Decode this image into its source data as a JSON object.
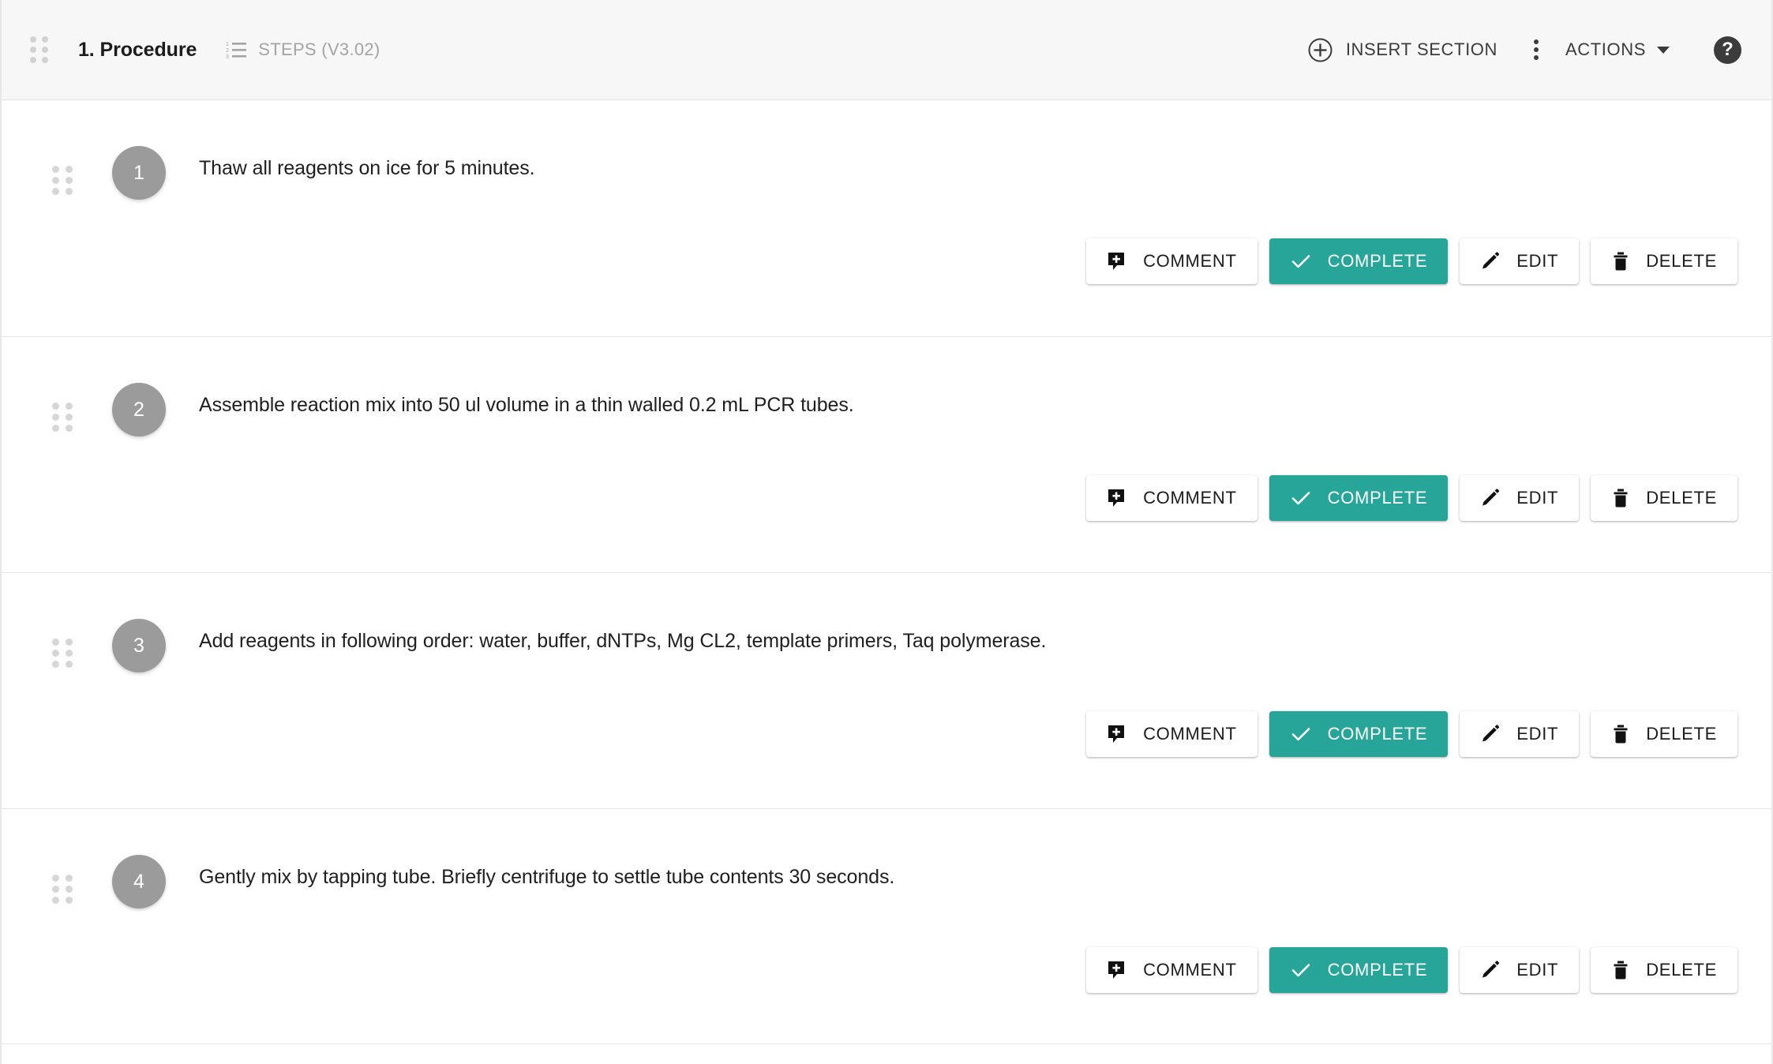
{
  "header": {
    "drag_handle": "drag-handle",
    "title": "1. Procedure",
    "steps_icon": "numbered-list-icon",
    "steps_label": "STEPS (V3.02)",
    "insert_section_label": "INSERT SECTION",
    "insert_section_icon": "plus-circle-icon",
    "kebab_icon": "more-vertical-icon",
    "actions_label": "ACTIONS",
    "actions_caret": "chevron-down-icon",
    "help_icon_label": "?"
  },
  "colors": {
    "accent_teal": "#26a598",
    "header_background": "#f7f7f7",
    "step_circle": "#9b9b9b",
    "muted_text": "#a4a4a4",
    "help_circle": "#3c3c3c"
  },
  "buttons": {
    "comment": "COMMENT",
    "complete": "COMPLETE",
    "edit": "EDIT",
    "delete": "DELETE"
  },
  "steps": [
    {
      "number": "1",
      "text": "Thaw all reagents on ice for 5 minutes."
    },
    {
      "number": "2",
      "text": "Assemble reaction mix into 50 ul volume in a thin walled 0.2 mL PCR tubes."
    },
    {
      "number": "3",
      "text": "Add reagents in following order: water, buffer, dNTPs, Mg CL2, template primers, Taq polymerase."
    },
    {
      "number": "4",
      "text": "Gently mix by tapping tube. Briefly centrifuge to settle tube contents 30 seconds."
    }
  ]
}
